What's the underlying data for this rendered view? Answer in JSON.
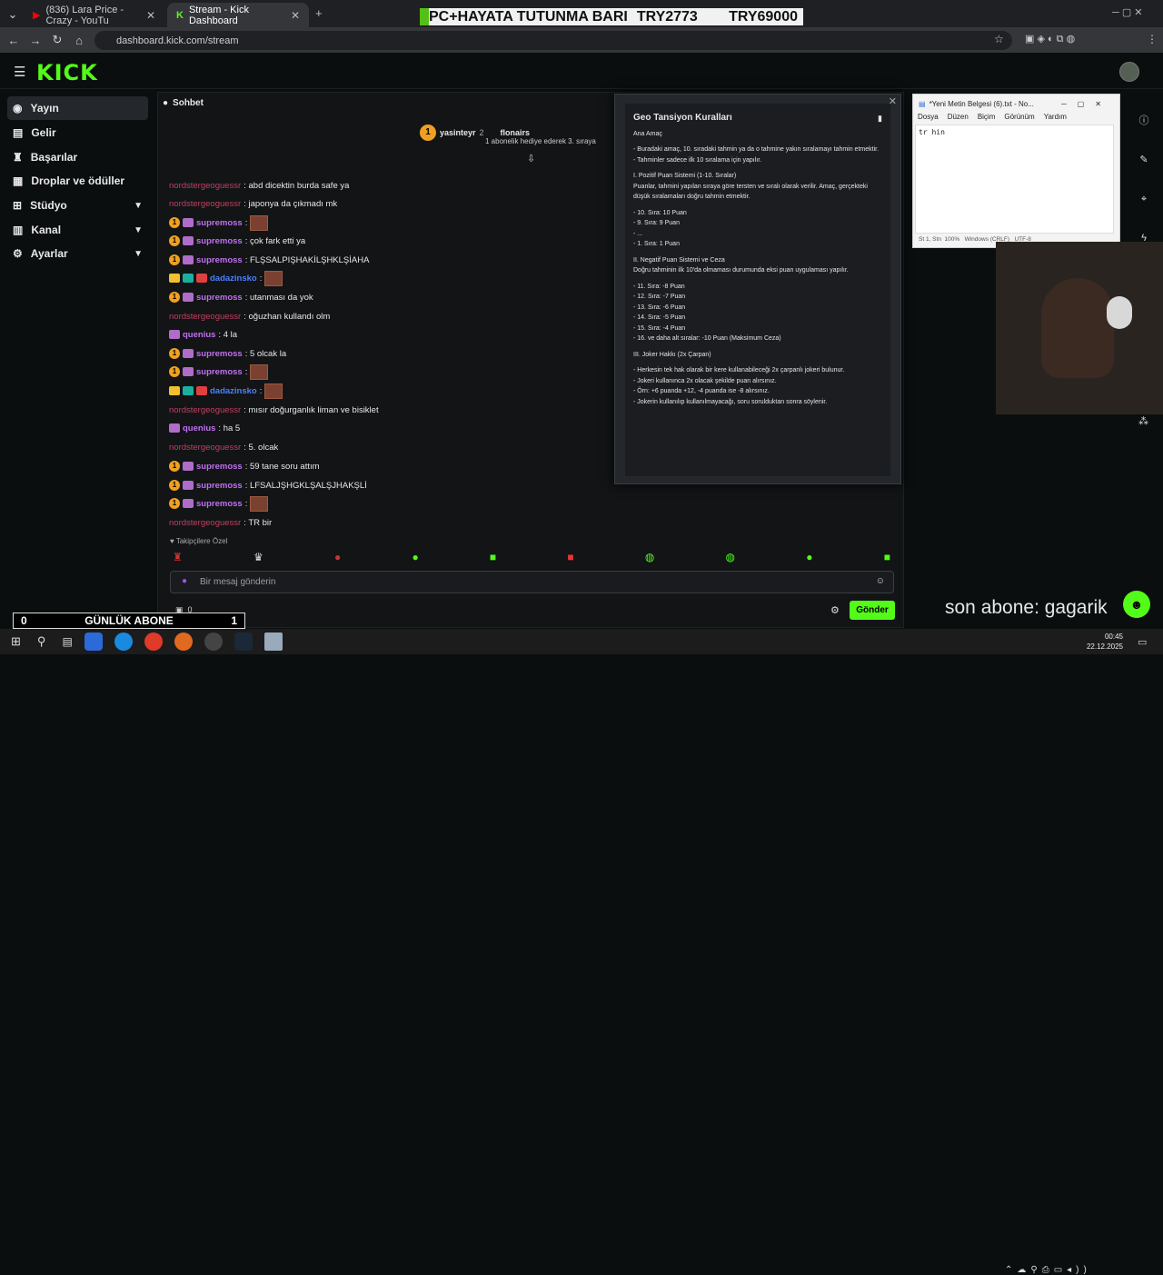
{
  "browser": {
    "tabs": [
      {
        "label": "(836) Lara Price - Crazy - YouTu",
        "active": false
      },
      {
        "label": "Stream - Kick Dashboard",
        "active": true
      }
    ],
    "url": "dashboard.kick.com/stream"
  },
  "overlay_top": {
    "left": "PC+HAYATA TUTUNMA BARI",
    "mid": "TRY2773",
    "right": "TRY69000"
  },
  "sidebar": {
    "items": [
      {
        "label": "Yayın",
        "icon": "broadcast-icon"
      },
      {
        "label": "Gelir",
        "icon": "money-icon"
      },
      {
        "label": "Başarılar",
        "icon": "trophy-icon"
      },
      {
        "label": "Droplar ve ödüller",
        "icon": "gift-icon"
      },
      {
        "label": "Stüdyo",
        "icon": "grid-icon"
      },
      {
        "label": "Kanal",
        "icon": "chart-icon"
      },
      {
        "label": "Ayarlar",
        "icon": "gear-icon"
      }
    ]
  },
  "chat": {
    "title": "Sohbet",
    "pinned": {
      "user1": "yasinteyr",
      "user1_count": "2",
      "user2": "flonairs",
      "note": "1 abonelik hediye ederek 3. sıraya"
    },
    "messages": [
      {
        "user": "nordstergeoguessr",
        "text": ": abd dicektin burda safe ya",
        "kind": "u1"
      },
      {
        "user": "nordstergeoguessr",
        "text": ": japonya da çıkmadı mk",
        "kind": "u1"
      },
      {
        "user": "supremoss",
        "text": ":",
        "kind": "u2",
        "emote": true
      },
      {
        "user": "supremoss",
        "text": ": çok fark etti ya",
        "kind": "u2"
      },
      {
        "user": "supremoss",
        "text": ": FLŞSALPIŞHAKİLŞHKLŞİAHA",
        "kind": "u2"
      },
      {
        "user": "dadazinsko",
        "text": ":",
        "kind": "u3",
        "emote": true
      },
      {
        "user": "supremoss",
        "text": ": utanması da yok",
        "kind": "u2"
      },
      {
        "user": "nordstergeoguessr",
        "text": ": oğuzhan kullandı olm",
        "kind": "u1"
      },
      {
        "user": "quenius",
        "text": ": 4 la",
        "kind": "u4"
      },
      {
        "user": "supremoss",
        "text": ": 5 olcak la",
        "kind": "u2"
      },
      {
        "user": "supremoss",
        "text": ":",
        "kind": "u2",
        "emote": true
      },
      {
        "user": "dadazinsko",
        "text": ":",
        "kind": "u3",
        "emote": true
      },
      {
        "user": "nordstergeoguessr",
        "text": ": mısır doğurganlık liman ve bisiklet",
        "kind": "u1"
      },
      {
        "user": "quenius",
        "text": ": ha 5",
        "kind": "u4"
      },
      {
        "user": "nordstergeoguessr",
        "text": ": 5. olcak",
        "kind": "u1"
      },
      {
        "user": "supremoss",
        "text": ": 59 tane soru attım",
        "kind": "u2"
      },
      {
        "user": "supremoss",
        "text": ": LFSALJŞHGKLŞALŞJHAKŞLİ",
        "kind": "u2"
      },
      {
        "user": "supremoss",
        "text": ":",
        "kind": "u2",
        "emote": true
      },
      {
        "user": "nordstergeoguessr",
        "text": ": TR bir",
        "kind": "u1"
      }
    ],
    "followers_only": "Takipçilere Özel",
    "input_placeholder": "Bir mesaj gönderin",
    "send_label": "Gönder",
    "counter": "0"
  },
  "rules": {
    "title": "Geo Tansiyon Kuralları",
    "lines": [
      "Ana Amaç",
      "",
      "- Buradaki amaç, 10. sıradaki tahmin ya da o tahmine yakın sıralamayı tahmin etmektir.",
      "- Tahminler sadece ilk 10 sıralama için yapılır.",
      "",
      "I. Pozitif Puan Sistemi (1-10. Sıralar)",
      "Puanlar, tahmini yapılan sıraya göre tersten ve sıralı olarak verilir. Amaç, gerçekteki düşük sıralamaları doğru tahmin etmektir.",
      "",
      "- 10. Sıra: 10 Puan",
      "- 9. Sıra: 9 Puan",
      "- ...",
      "- 1. Sıra: 1 Puan",
      "",
      "II. Negatif Puan Sistemi ve Ceza",
      "Doğru tahminin ilk 10'da olmaması durumunda eksi puan uygulaması yapılır.",
      "",
      "- 11. Sıra: -8 Puan",
      "- 12. Sıra: -7 Puan",
      "- 13. Sıra: -6 Puan",
      "- 14. Sıra: -5 Puan",
      "- 15. Sıra: -4 Puan",
      "- 16. ve daha alt sıralar: -10 Puan (Maksimum Ceza)",
      "",
      "III. Joker Hakkı (2x Çarpan)",
      "",
      "- Herkesin tek hak olarak bir kere kullanabileceği 2x çarpanlı jokeri bulunur.",
      "- Jokeri kullanınca 2x olacak şekilde puan alırsınız.",
      "- Örn: +6 puanda +12, -4 puanda ise -8 alırsınız.",
      "- Jokerin kullanılıp kullanılmayacağı, soru sorulduktan sonra söylenir."
    ]
  },
  "notepad": {
    "title": "*Yeni Metin Belgesi (6).txt - No...",
    "menu": [
      "Dosya",
      "Düzen",
      "Biçim",
      "Görünüm",
      "Yardım"
    ],
    "content": "tr hin",
    "status": "St 1, Stn  100%   Windows (CRLF)   UTF-8"
  },
  "overlays": {
    "gunluk_label": "GÜNLÜK ABONE",
    "gunluk_left": "0",
    "gunluk_right": "1",
    "son_abone": "son abone: gagarik"
  },
  "taskbar": {
    "time": "00:45",
    "date": "22.12.2025"
  },
  "colors": {
    "kick_green": "#53fc18",
    "bg": "#0b0e0f"
  }
}
